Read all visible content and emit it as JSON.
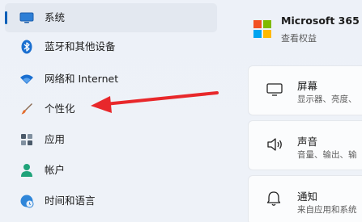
{
  "sidebar": {
    "items": [
      {
        "label": "系统",
        "icon": "monitor-icon"
      },
      {
        "label": "蓝牙和其他设备",
        "icon": "bluetooth-icon"
      },
      {
        "label": "网络和 Internet",
        "icon": "wifi-icon"
      },
      {
        "label": "个性化",
        "icon": "brush-icon"
      },
      {
        "label": "应用",
        "icon": "apps-icon"
      },
      {
        "label": "帐户",
        "icon": "person-icon"
      },
      {
        "label": "时间和语言",
        "icon": "globe-clock-icon"
      }
    ]
  },
  "main": {
    "microsoft365": {
      "title": "Microsoft 365",
      "subtitle": "查看权益"
    },
    "cards": [
      {
        "title": "屏幕",
        "subtitle": "显示器、亮度、",
        "icon": "display-icon"
      },
      {
        "title": "声音",
        "subtitle": "音量、输出、输",
        "icon": "speaker-icon"
      },
      {
        "title": "通知",
        "subtitle": "来自应用和系统",
        "icon": "bell-icon"
      }
    ]
  },
  "colors": {
    "accent": "#005fb8",
    "annotation_arrow": "#e8282b"
  }
}
